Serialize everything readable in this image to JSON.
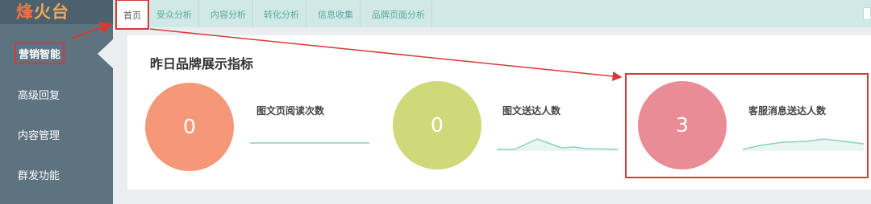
{
  "logo": {
    "part1": "烽",
    "part2": "火台"
  },
  "sidebar": {
    "items": [
      {
        "label": "营销智能",
        "active": true
      },
      {
        "label": "高级回复"
      },
      {
        "label": "内容管理"
      },
      {
        "label": "群发功能"
      }
    ]
  },
  "tabs": [
    {
      "label": "首页",
      "active": true
    },
    {
      "label": "受众分析"
    },
    {
      "label": "内容分析"
    },
    {
      "label": "转化分析"
    },
    {
      "label": "信息收集"
    },
    {
      "label": "品牌页面分析"
    }
  ],
  "main": {
    "title": "昨日品牌展示指标",
    "metrics": [
      {
        "label": "图文页阅读次数",
        "value": "0",
        "color": "#f59878"
      },
      {
        "label": "图文送达人数",
        "value": "0",
        "color": "#cfd97a"
      },
      {
        "label": "客服消息送达人数",
        "value": "3",
        "color": "#e98c95"
      }
    ]
  },
  "colors": {
    "sidebar": "#5d7380",
    "tabbar": "#d0e8e6",
    "annotation_red": "#d53a34",
    "sparkline": "#8ecfc6"
  }
}
